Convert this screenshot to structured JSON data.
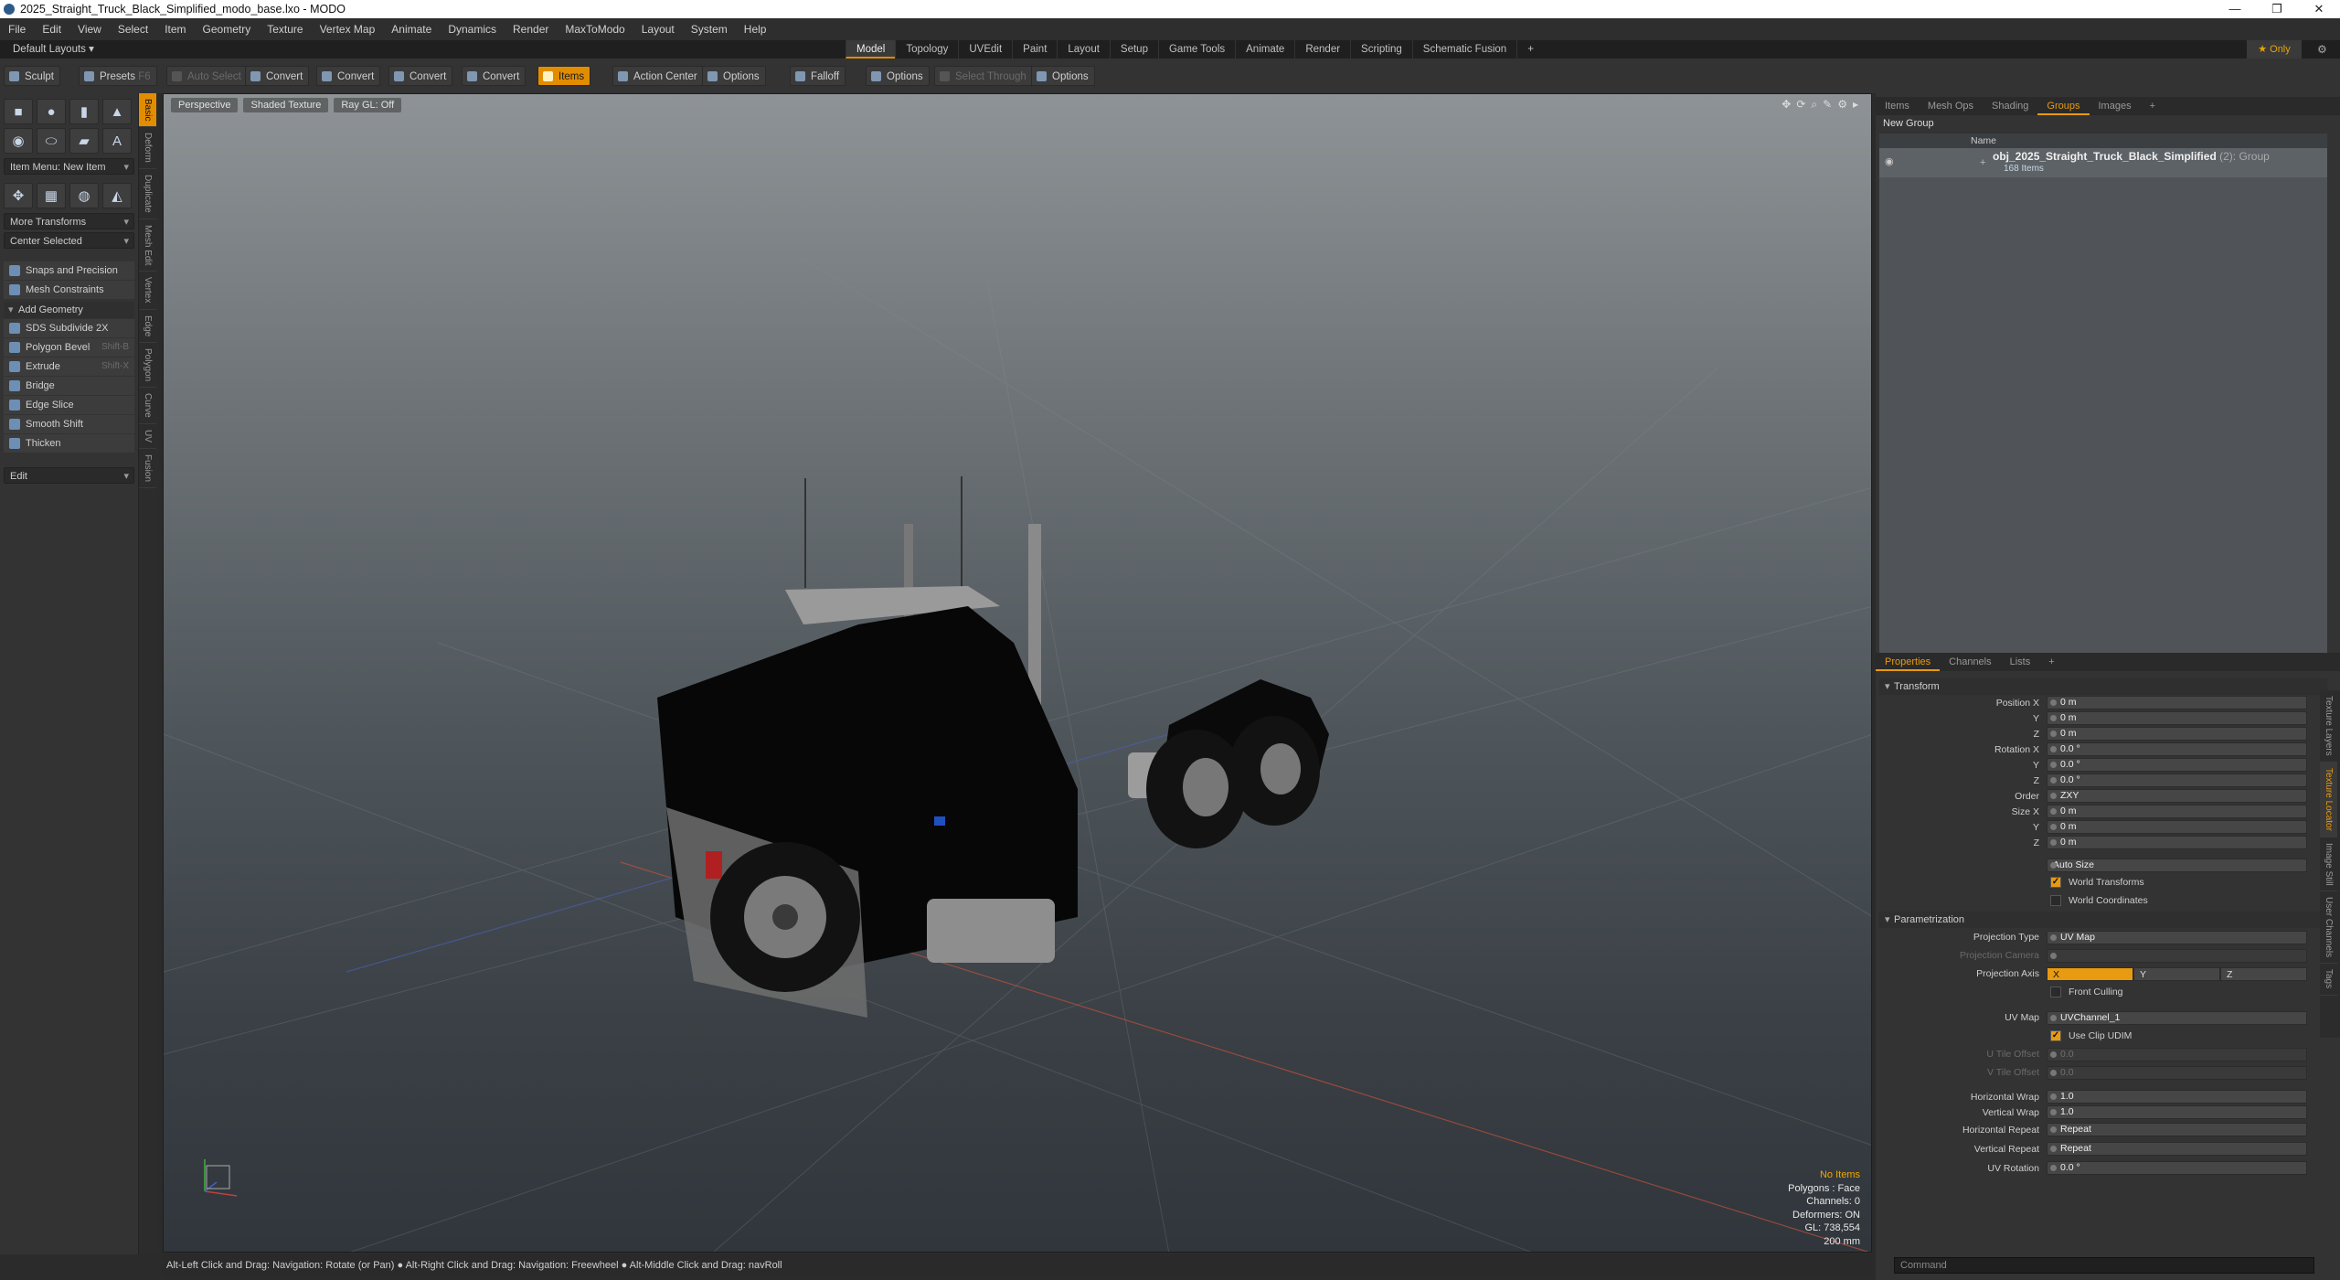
{
  "window": {
    "title": "2025_Straight_Truck_Black_Simplified_modo_base.lxo - MODO"
  },
  "menu": [
    "File",
    "Edit",
    "View",
    "Select",
    "Item",
    "Geometry",
    "Texture",
    "Vertex Map",
    "Animate",
    "Dynamics",
    "Render",
    "MaxToModo",
    "Layout",
    "System",
    "Help"
  ],
  "layouts": {
    "default": "Default Layouts ▾",
    "tabs": [
      "Model",
      "Topology",
      "UVEdit",
      "Paint",
      "Layout",
      "Setup",
      "Game Tools",
      "Animate",
      "Render",
      "Scripting",
      "Schematic Fusion",
      "+"
    ],
    "only": "★ Only"
  },
  "toolbar": {
    "sculpt": "Sculpt",
    "presets": "Presets",
    "presets_key": "F6",
    "auto_select": "Auto Select",
    "convert": "Convert",
    "items": "Items",
    "action_center": "Action Center",
    "options": "Options",
    "falloff": "Falloff",
    "select_through": "Select Through"
  },
  "left": {
    "item_menu": "Item Menu: New Item",
    "more_transforms": "More Transforms",
    "center_selected": "Center Selected",
    "snaps": "Snaps and Precision",
    "mesh_constraints": "Mesh Constraints",
    "add_geometry": "Add Geometry",
    "tools": [
      {
        "label": "SDS Subdivide 2X",
        "key": ""
      },
      {
        "label": "Polygon Bevel",
        "key": "Shift-B"
      },
      {
        "label": "Extrude",
        "key": "Shift-X"
      },
      {
        "label": "Bridge",
        "key": ""
      },
      {
        "label": "Edge Slice",
        "key": ""
      },
      {
        "label": "Smooth Shift",
        "key": ""
      },
      {
        "label": "Thicken",
        "key": ""
      }
    ],
    "edit": "Edit",
    "vtabs": [
      "Basic",
      "Deform",
      "Duplicate",
      "Mesh Edit",
      "Vertex",
      "Edge",
      "Polygon",
      "Curve",
      "UV",
      "Fusion"
    ]
  },
  "viewport": {
    "tabs": [
      "Perspective",
      "Shaded Texture",
      "Ray GL: Off"
    ],
    "stats": [
      "No Items",
      "Polygons : Face",
      "Channels: 0",
      "Deformers: ON",
      "GL: 738,554",
      "200 mm"
    ]
  },
  "status": "Alt-Left Click and Drag: Navigation: Rotate (or Pan) ● Alt-Right Click and Drag: Navigation: Freewheel ● Alt-Middle Click and Drag: navRoll",
  "right": {
    "top_tabs": [
      "Items",
      "Mesh Ops",
      "Shading",
      "Groups",
      "Images",
      "+"
    ],
    "new_group": "New Group",
    "col_name": "Name",
    "item_name": "obj_2025_Straight_Truck_Black_Simplified",
    "item_count": "(2)",
    "item_type": ": Group",
    "item_sub": "168 Items",
    "prop_tabs": [
      "Properties",
      "Channels",
      "Lists",
      "+"
    ],
    "transform": "Transform",
    "pos_label": "Position X",
    "rot_label": "Rotation X",
    "size_label": "Size X",
    "y": "Y",
    "z": "Z",
    "pos": [
      "0 m",
      "0 m",
      "0 m"
    ],
    "rot": [
      "0.0 °",
      "0.0 °",
      "0.0 °"
    ],
    "order_label": "Order",
    "order": "ZXY",
    "size": [
      "0 m",
      "0 m",
      "0 m"
    ],
    "auto_size": "Auto Size",
    "world_transforms": "World Transforms",
    "world_coordinates": "World Coordinates",
    "param": "Parametrization",
    "proj_type_label": "Projection Type",
    "proj_type": "UV Map",
    "proj_cam_label": "Projection Camera",
    "proj_axis_label": "Projection Axis",
    "axes": [
      "X",
      "Y",
      "Z"
    ],
    "front_culling": "Front Culling",
    "uv_map_label": "UV Map",
    "uv_map": "UVChannel_1",
    "use_clip": "Use Clip UDIM",
    "u_off_label": "U Tile Offset",
    "v_off_label": "V Tile Offset",
    "u_off": "0.0",
    "v_off": "0.0",
    "hwrap_label": "Horizontal Wrap",
    "vwrap_label": "Vertical Wrap",
    "hwrap": "1.0",
    "vwrap": "1.0",
    "hrep_label": "Horizontal Repeat",
    "vrep_label": "Vertical Repeat",
    "hrep": "Repeat",
    "vrep": "Repeat",
    "uvrot_label": "UV Rotation",
    "uvrot": "0.0 °",
    "rvtabs": [
      "Texture Layers",
      "Texture Locator",
      "Image Still",
      "User Channels",
      "Tags"
    ],
    "command": "Command"
  }
}
